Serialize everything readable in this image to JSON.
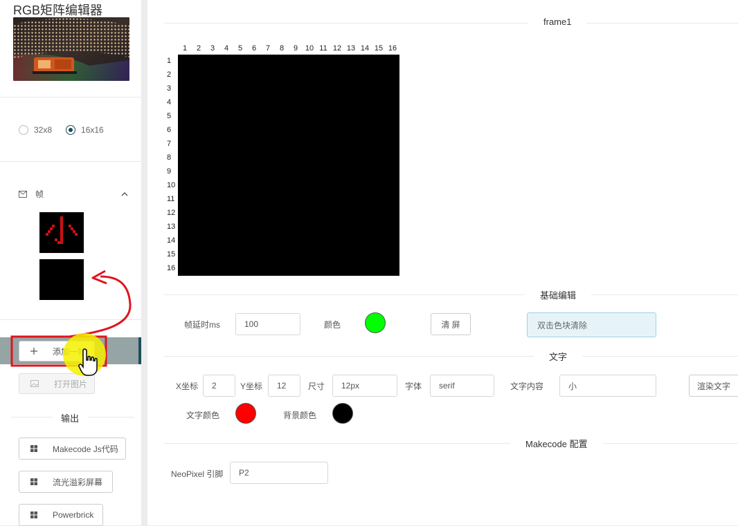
{
  "app": {
    "title": "RGB矩阵编辑器"
  },
  "size_options": [
    {
      "label": "32x8",
      "selected": false
    },
    {
      "label": "16x16",
      "selected": true
    }
  ],
  "frames": {
    "header_label": "帧",
    "header_icon": "mail-icon",
    "toggle_icon": "chevron-up-icon",
    "thumbnails": [
      "frame-thumb-xiao",
      "frame-thumb-blank"
    ]
  },
  "buttons": {
    "add_frame": "添加一帧",
    "open_image": "打开图片"
  },
  "output": {
    "title": "输出",
    "items": [
      "Makecode Js代码",
      "流光溢彩屏幕",
      "Powerbrick"
    ]
  },
  "main": {
    "frame_title": "frame1",
    "cols": [
      "1",
      "2",
      "3",
      "4",
      "5",
      "6",
      "7",
      "8",
      "9",
      "10",
      "11",
      "12",
      "13",
      "14",
      "15",
      "16"
    ],
    "rows": [
      "1",
      "2",
      "3",
      "4",
      "5",
      "6",
      "7",
      "8",
      "9",
      "10",
      "11",
      "12",
      "13",
      "14",
      "15",
      "16"
    ],
    "basic_edit": {
      "title": "基础编辑",
      "delay_label": "帧延时ms",
      "delay_value": "100",
      "color_label": "颜色",
      "color_value": "#00ff00",
      "clear_button": "清 屏",
      "hint": "双击色块清除"
    },
    "text": {
      "title": "文字",
      "x_label": "X坐标",
      "x_value": "2",
      "y_label": "Y坐标",
      "y_value": "12",
      "size_label": "尺寸",
      "size_value": "12px",
      "font_label": "字体",
      "font_value": "serif",
      "content_label": "文字内容",
      "content_value": "小",
      "render_button": "渲染文字",
      "text_color_label": "文字颜色",
      "text_color_value": "#ff0000",
      "bg_color_label": "背景颜色",
      "bg_color_value": "#000000"
    },
    "makecode": {
      "title": "Makecode 配置",
      "pin_label": "NeoPixel 引脚",
      "pin_value": "P2"
    }
  },
  "accent_color": "#1a4b5c",
  "annotation_color": "#e0141e",
  "cursor_highlight_color": "#f5f000"
}
